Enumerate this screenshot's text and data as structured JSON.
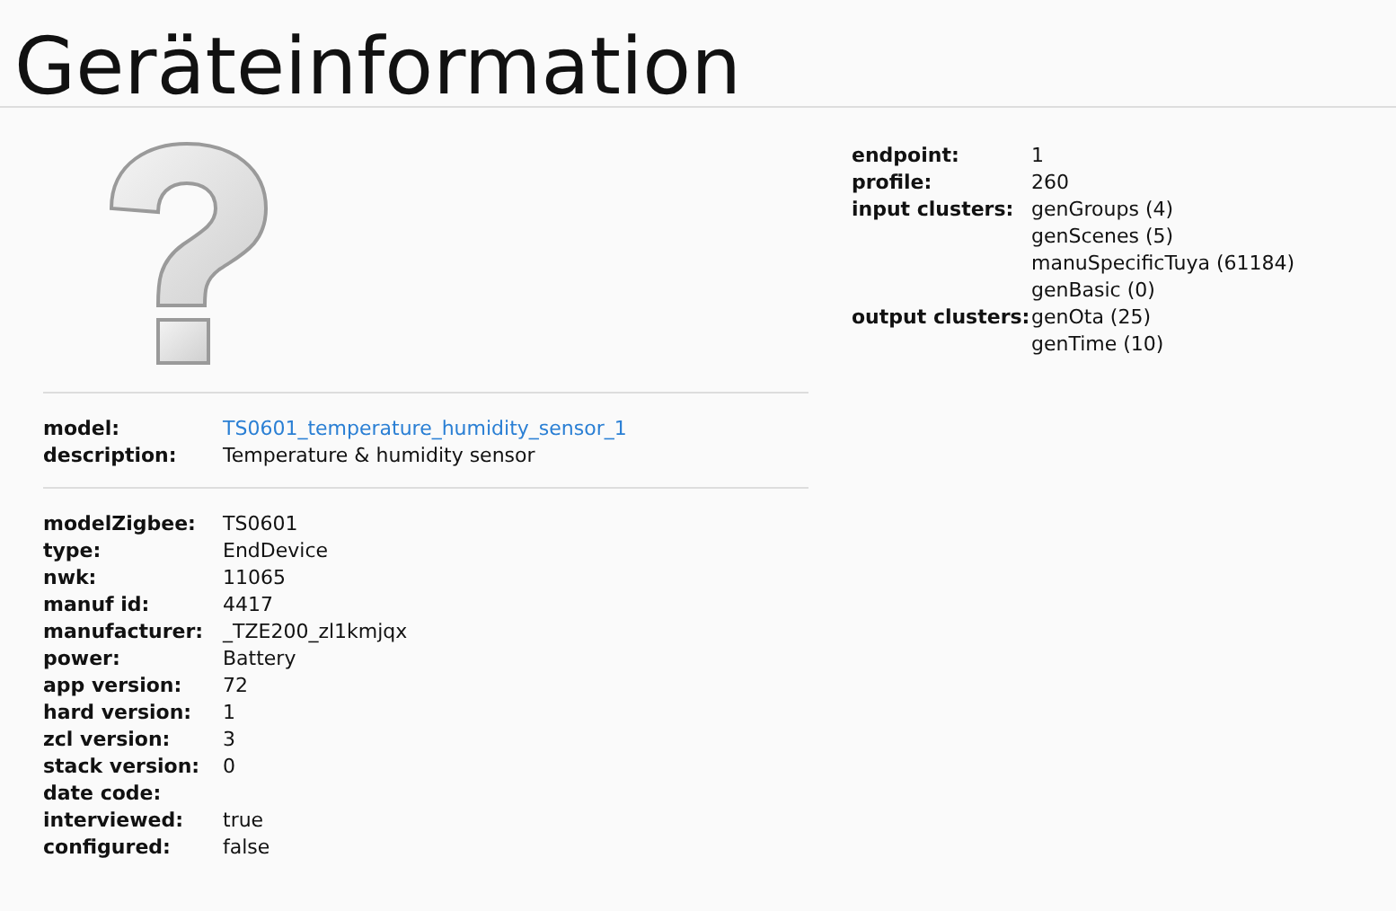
{
  "title": "Geräteinformation",
  "model_info": [
    {
      "label": "model:",
      "value": "TS0601_temperature_humidity_sensor_1",
      "kind": "link"
    },
    {
      "label": "description:",
      "value": "Temperature & humidity sensor",
      "kind": "text"
    }
  ],
  "details": [
    {
      "label": "modelZigbee:",
      "value": "TS0601"
    },
    {
      "label": "type:",
      "value": "EndDevice"
    },
    {
      "label": "nwk:",
      "value": "11065"
    },
    {
      "label": "manuf id:",
      "value": "4417"
    },
    {
      "label": "manufacturer:",
      "value": "_TZE200_zl1kmjqx"
    },
    {
      "label": "power:",
      "value": "Battery"
    },
    {
      "label": "app version:",
      "value": "72"
    },
    {
      "label": "hard version:",
      "value": "1"
    },
    {
      "label": "zcl version:",
      "value": "3"
    },
    {
      "label": "stack version:",
      "value": "0"
    },
    {
      "label": "date code:"
    },
    {
      "label": "interviewed:",
      "value": "true"
    },
    {
      "label": "configured:",
      "value": "false"
    }
  ],
  "endpoint": [
    {
      "label": "endpoint:",
      "values": [
        "1"
      ]
    },
    {
      "label": "profile:",
      "values": [
        "260"
      ]
    },
    {
      "label": "input clusters:",
      "values": [
        "genGroups (4)",
        "genScenes (5)",
        "manuSpecificTuya (61184)",
        "genBasic (0)"
      ]
    },
    {
      "label": "output clusters:",
      "values": [
        "genOta (25)",
        "genTime (10)"
      ]
    }
  ]
}
